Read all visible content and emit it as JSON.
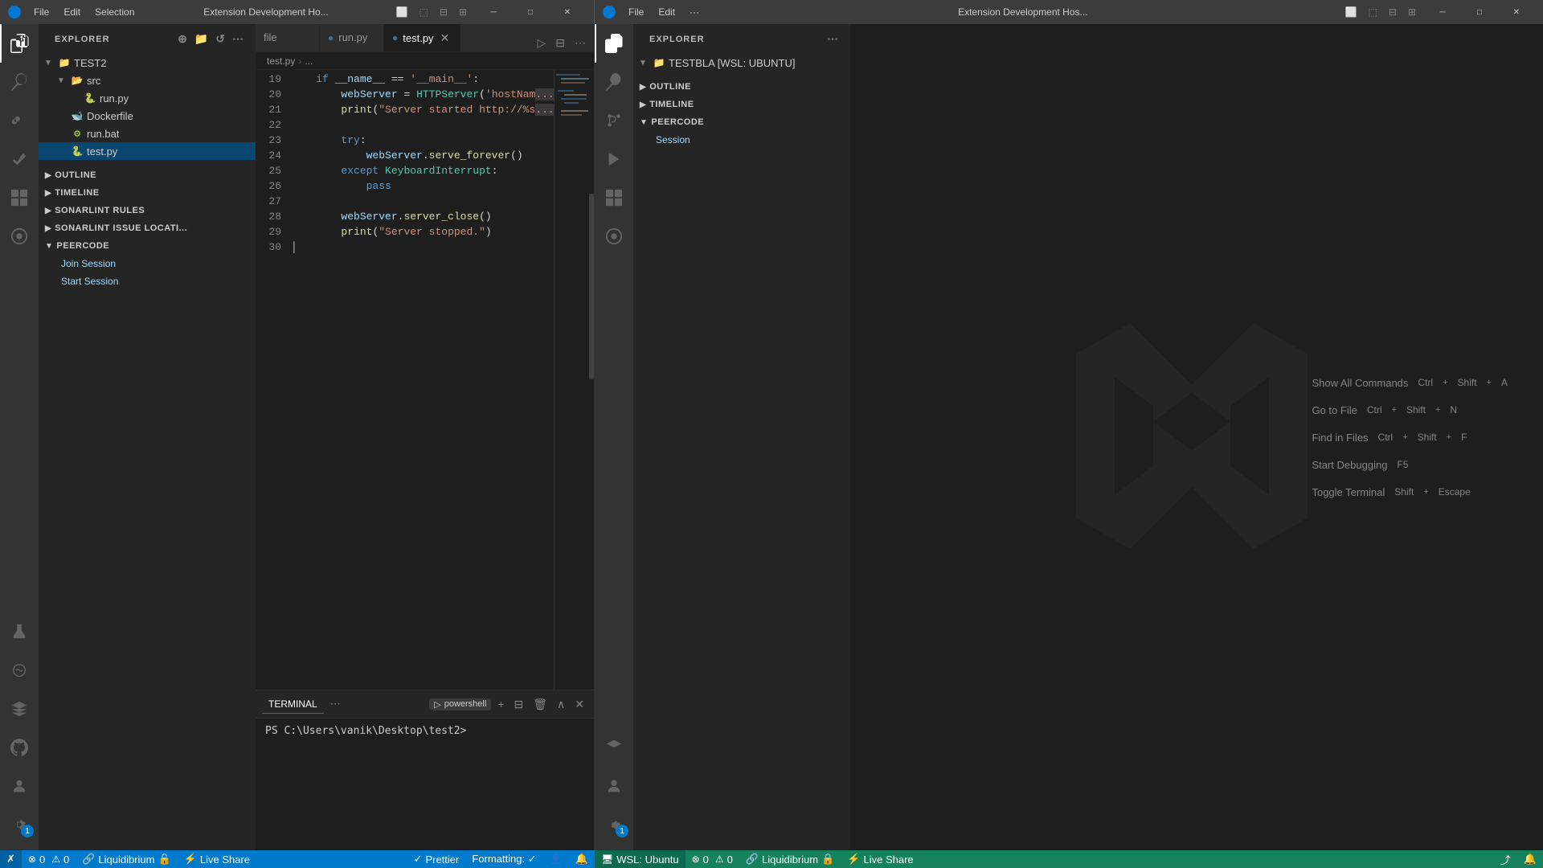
{
  "left_window": {
    "title": "Extension Development Ho...",
    "menu": [
      "File",
      "Edit",
      "Selection"
    ],
    "tabs": [
      {
        "name": "file",
        "label": "file",
        "active": false,
        "dirty": false
      },
      {
        "name": "run.py",
        "label": "run.py",
        "active": false,
        "dirty": false
      },
      {
        "name": "test.py",
        "label": "test.py",
        "active": true,
        "dirty": false
      }
    ],
    "breadcrumb": [
      "test.py",
      "..."
    ],
    "explorer": {
      "title": "EXPLORER",
      "root": "TEST2",
      "items": [
        {
          "type": "folder",
          "label": "src",
          "depth": 1,
          "open": true
        },
        {
          "type": "file",
          "label": "run.py",
          "depth": 2,
          "icon": "py"
        },
        {
          "type": "file",
          "label": "Dockerfile",
          "depth": 1,
          "icon": "docker"
        },
        {
          "type": "file",
          "label": "run.bat",
          "depth": 1,
          "icon": "bat"
        },
        {
          "type": "file",
          "label": "test.py",
          "depth": 1,
          "icon": "py",
          "selected": true
        }
      ]
    },
    "sections": [
      {
        "id": "outline",
        "label": "OUTLINE",
        "open": false
      },
      {
        "id": "timeline",
        "label": "TIMELINE",
        "open": false
      },
      {
        "id": "sonarlint-rules",
        "label": "SONARLINT RULES",
        "open": false
      },
      {
        "id": "sonarlint-issue",
        "label": "SONARLINT ISSUE LOCATI...",
        "open": false
      },
      {
        "id": "peercode",
        "label": "PEERCODE",
        "open": true
      }
    ],
    "peercode_items": [
      "Join Session",
      "Start Session"
    ],
    "code": {
      "lines": [
        {
          "num": 19,
          "content": "    if __name__ == '__main__':"
        },
        {
          "num": 20,
          "content": "        webServer = HTTPServer('hostNam"
        },
        {
          "num": 21,
          "content": "        print(\"Server started http://%s"
        },
        {
          "num": 22,
          "content": ""
        },
        {
          "num": 23,
          "content": "        try:"
        },
        {
          "num": 24,
          "content": "            webServer.serve_forever()"
        },
        {
          "num": 25,
          "content": "        except KeyboardInterrupt:"
        },
        {
          "num": 26,
          "content": "            pass"
        },
        {
          "num": 27,
          "content": ""
        },
        {
          "num": 28,
          "content": "        webServer.server_close()"
        },
        {
          "num": 29,
          "content": "        print(\"Server stopped.\")"
        },
        {
          "num": 30,
          "content": ""
        }
      ]
    },
    "terminal": {
      "tab_label": "TERMINAL",
      "shell": "powershell",
      "prompt": "PS C:\\Users\\vanik\\Desktop\\test2>"
    },
    "status_bar": {
      "items_left": [
        {
          "icon": "✗",
          "text": ""
        },
        {
          "icon": "",
          "text": "⊗ 0  ⚠ 0"
        },
        {
          "icon": "🔗",
          "text": "Liquidibrium 🔒"
        },
        {
          "icon": "",
          "text": "⚡ Live Share"
        }
      ],
      "items_right": [
        {
          "icon": "",
          "text": "✓ Prettier"
        },
        {
          "icon": "",
          "text": "Formatting: ✓"
        },
        {
          "icon": "👤",
          "text": ""
        },
        {
          "icon": "🔔",
          "text": ""
        }
      ]
    }
  },
  "right_window": {
    "title": "Extension Development Hos...",
    "menu": [
      "File",
      "Edit",
      "···"
    ],
    "explorer": {
      "title": "EXPLORER",
      "root": "TESTBLA [WSL: UBUNTU]"
    },
    "sections": [
      {
        "id": "outline",
        "label": "OUTLINE",
        "open": false
      },
      {
        "id": "timeline",
        "label": "TIMELINE",
        "open": false
      },
      {
        "id": "peercode",
        "label": "PEERCODE",
        "open": true
      }
    ],
    "peercode_items": [
      "Session"
    ],
    "shortcuts": [
      {
        "label": "Show All Commands",
        "keys": [
          "Ctrl",
          "+",
          "Shift",
          "+",
          "A"
        ]
      },
      {
        "label": "Go to File",
        "keys": [
          "Ctrl",
          "+",
          "Shift",
          "+",
          "N"
        ]
      },
      {
        "label": "Find in Files",
        "keys": [
          "Ctrl",
          "+",
          "Shift",
          "+",
          "F"
        ]
      },
      {
        "label": "Start Debugging",
        "keys": [
          "F5"
        ]
      },
      {
        "label": "Toggle Terminal",
        "keys": [
          "Shift",
          "+",
          "Escape"
        ]
      }
    ],
    "status_bar": {
      "bg": "#16825d",
      "items": [
        {
          "icon": "🖥",
          "text": "WSL: Ubuntu"
        },
        {
          "icon": "",
          "text": "⊗ 0  ⚠ 0"
        },
        {
          "icon": "🔗",
          "text": "Liquidibrium 🔒"
        },
        {
          "icon": "⚡",
          "text": "Live Share"
        }
      ]
    }
  },
  "icons": {
    "files": "⬛",
    "search": "🔍",
    "git": "⎇",
    "run": "▶",
    "extensions": "⊞",
    "remote": "⊡",
    "flask": "⚗",
    "person": "👤",
    "settings": "⚙",
    "github": "⦿",
    "liveshare": "⚡"
  }
}
